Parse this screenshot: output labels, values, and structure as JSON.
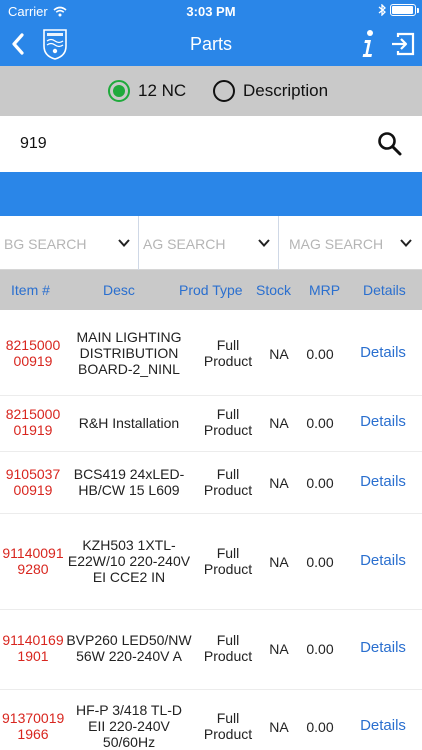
{
  "statusbar": {
    "carrier": "Carrier",
    "time": "3:03 PM",
    "battery_level": 0.95,
    "icons": [
      "wifi-icon",
      "bluetooth-icon",
      "battery-icon"
    ]
  },
  "navbar": {
    "title": "Parts",
    "icons": [
      "back-chevron-icon",
      "philips-logo-icon",
      "info-icon",
      "logout-icon"
    ]
  },
  "search_mode": {
    "options": [
      "12 NC",
      "Description"
    ],
    "selected": "12 NC"
  },
  "search": {
    "value": "919",
    "icon": "search-icon"
  },
  "filters": [
    "BG SEARCH",
    "AG SEARCH",
    "MAG SEARCH"
  ],
  "table": {
    "headers": [
      "Item #",
      "Desc",
      "Prod Type",
      "Stock",
      "MRP",
      "Details"
    ],
    "rows": [
      {
        "item": "8215000\n00919",
        "desc": "MAIN LIGHTING\nDISTRIBUTION\nBOARD-2_NINL",
        "ptype": "Full\nProduct",
        "stock": "NA",
        "mrp": "0.00",
        "details": "Details"
      },
      {
        "item": "8215000\n01919",
        "desc": "R&H Installation",
        "ptype": "Full\nProduct",
        "stock": "NA",
        "mrp": "0.00",
        "details": "Details"
      },
      {
        "item": "9105037\n00919",
        "desc": "BCS419 24xLED-\nHB/CW 15 L609",
        "ptype": "Full\nProduct",
        "stock": "NA",
        "mrp": "0.00",
        "details": "Details"
      },
      {
        "item": "91140091\n9280",
        "desc": "KZH503 1XTL-\nE22W/10 220-240V\nEI CCE2 IN",
        "ptype": "Full\nProduct",
        "stock": "NA",
        "mrp": "0.00",
        "details": "Details"
      },
      {
        "item": "91140169\n1901",
        "desc": "BVP260 LED50/NW\n56W 220-240V A",
        "ptype": "Full\nProduct",
        "stock": "NA",
        "mrp": "0.00",
        "details": "Details"
      },
      {
        "item": "91370019\n1966",
        "desc": "HF-P 3/418 TL-D\nEII 220-240V\n50/60Hz",
        "ptype": "Full\nProduct",
        "stock": "NA",
        "mrp": "0.00",
        "details": "Details"
      }
    ]
  },
  "colors": {
    "accent": "#2a86e8",
    "item_red": "#d8261f",
    "link_blue": "#2a6fcf",
    "radio_green": "#1faa3c",
    "band_gray": "#c9c9c9"
  }
}
